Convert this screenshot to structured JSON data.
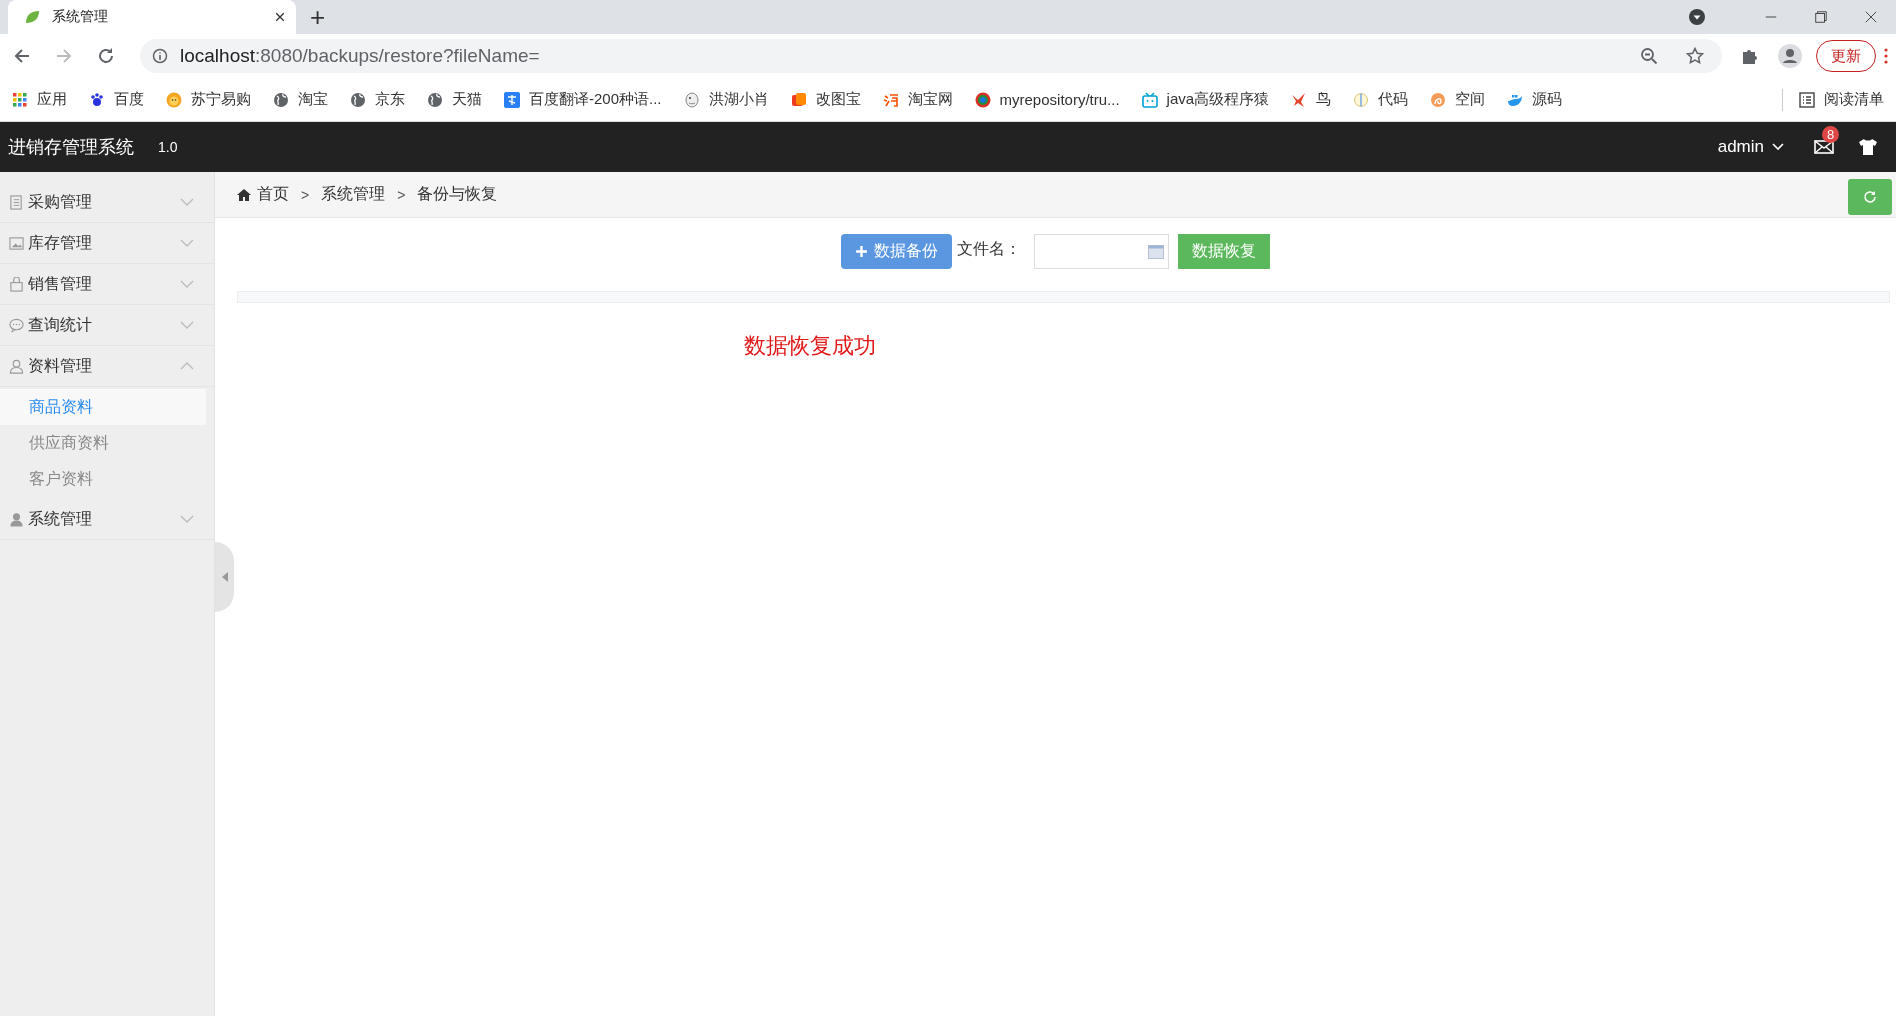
{
  "browser": {
    "tab_title": "系统管理",
    "new_tab": "+",
    "url_host": "localhost",
    "url_path": ":8080/backups/restore?fileName=",
    "update_button": "更新",
    "bookmarks": [
      {
        "label": "应用"
      },
      {
        "label": "百度"
      },
      {
        "label": "苏宁易购"
      },
      {
        "label": "淘宝"
      },
      {
        "label": "京东"
      },
      {
        "label": "天猫"
      },
      {
        "label": "百度翻译-200种语..."
      },
      {
        "label": "洪湖小肖"
      },
      {
        "label": "改图宝"
      },
      {
        "label": "淘宝网"
      },
      {
        "label": "myrepository/tru..."
      },
      {
        "label": "java高级程序猿"
      },
      {
        "label": "鸟"
      },
      {
        "label": "代码"
      },
      {
        "label": "空间"
      },
      {
        "label": "源码"
      }
    ],
    "reading_list": "阅读清单"
  },
  "app": {
    "title": "进销存管理系统",
    "version": "1.0",
    "user": "admin",
    "mail_badge": "8"
  },
  "sidebar": {
    "items": [
      {
        "label": "采购管理",
        "expanded": false
      },
      {
        "label": "库存管理",
        "expanded": false
      },
      {
        "label": "销售管理",
        "expanded": false
      },
      {
        "label": "查询统计",
        "expanded": false
      },
      {
        "label": "资料管理",
        "expanded": true,
        "children": [
          {
            "label": "商品资料",
            "selected": true
          },
          {
            "label": "供应商资料",
            "selected": false
          },
          {
            "label": "客户资料",
            "selected": false
          }
        ]
      },
      {
        "label": "系统管理",
        "expanded": false
      }
    ]
  },
  "breadcrumb": [
    {
      "label": "首页"
    },
    {
      "separator": ">",
      "label": "系统管理"
    },
    {
      "separator": ">",
      "label": "备份与恢复"
    }
  ],
  "toolbar": {
    "backup_button": "数据备份",
    "filename_label": "文件名：",
    "restore_button": "数据恢复"
  },
  "message": "数据恢复成功"
}
